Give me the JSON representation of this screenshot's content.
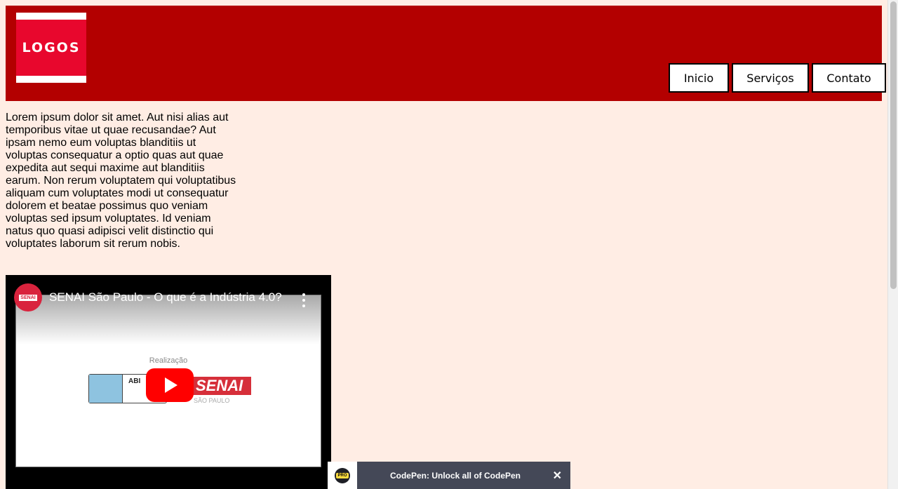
{
  "header": {
    "logo_text": "LOGOS",
    "nav": [
      {
        "label": "Inicio"
      },
      {
        "label": "Serviços"
      },
      {
        "label": "Contato"
      }
    ]
  },
  "content": {
    "paragraph": "Lorem ipsum dolor sit amet. Aut nisi alias aut temporibus vitae ut quae recusandae? Aut ipsam nemo eum voluptas blanditiis ut voluptas consequatur a optio quas aut quae expedita aut sequi maxime aut blanditiis earum. Non rerum voluptatem qui voluptatibus aliquam cum voluptates modi ut consequatur dolorem et beatae possimus quo veniam voluptas sed ipsum voluptates. Id veniam natus quo quasi adipisci velit distinctio qui voluptates laborum sit rerum nobis."
  },
  "video": {
    "title": "SENAI São Paulo - O que é a Indústria 4.0?",
    "channel_badge": "SENAI",
    "thumbnail": {
      "realizacao": "Realização",
      "abi_text": "ABI",
      "senai_text": "SENAI",
      "senai_sub": "SÃO PAULO"
    }
  },
  "codepen_banner": {
    "pro_badge": "PRO",
    "text": "CodePen: Unlock all of CodePen",
    "close": "✕"
  },
  "colors": {
    "header_bg": "#b30000",
    "page_bg": "#ffede4",
    "logo_red": "#e8072d",
    "play_red": "#ff0000"
  }
}
